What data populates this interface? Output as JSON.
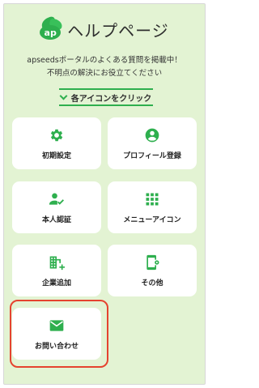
{
  "header": {
    "logo_text": "ap",
    "title": "ヘルプページ"
  },
  "description": {
    "line1": "apseedsポータルのよくある質問を掲載中！",
    "line2": "不明点の解決にお役立てください"
  },
  "toggle": {
    "label": "各アイコンをクリック"
  },
  "menu": [
    {
      "label": "初期設定",
      "icon": "gear-icon"
    },
    {
      "label": "プロフィール登録",
      "icon": "user-circle-icon"
    },
    {
      "label": "本人認証",
      "icon": "user-check-icon"
    },
    {
      "label": "メニューアイコン",
      "icon": "grid-icon"
    },
    {
      "label": "企業追加",
      "icon": "building-add-icon"
    },
    {
      "label": "その他",
      "icon": "phone-gear-icon"
    },
    {
      "label": "お問い合わせ",
      "icon": "mail-icon"
    }
  ],
  "colors": {
    "accent": "#2eaf4e",
    "background": "#e3f3d3",
    "highlight": "#e5432f"
  }
}
